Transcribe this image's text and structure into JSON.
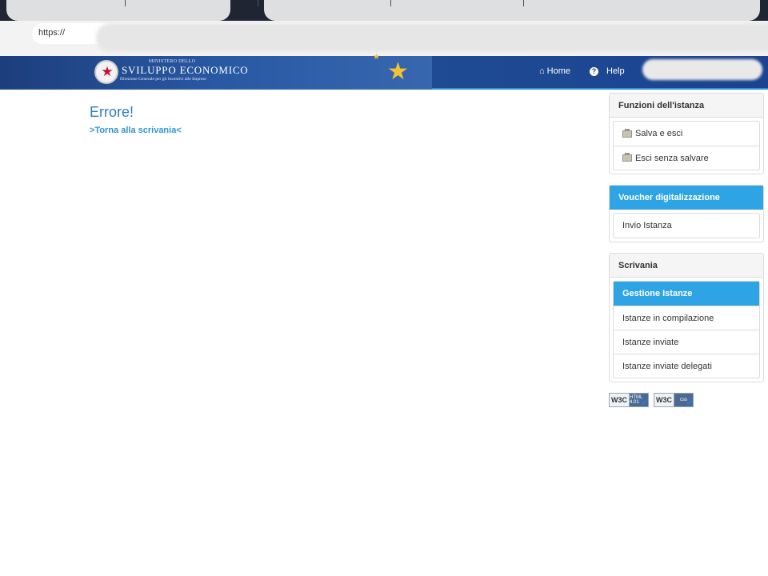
{
  "browser": {
    "url_prefix": "https://"
  },
  "header": {
    "brand_kicker": "MINISTERO DELLO",
    "brand_title": "SVILUPPO ECONOMICO",
    "brand_subtitle": "Direzione Generale per gli Incentivi alle Imprese",
    "nav": {
      "home": "Home",
      "help": "Help"
    }
  },
  "main": {
    "title": "Errore!",
    "back_link": ">Torna alla scrivania<"
  },
  "sidebar": {
    "funzioni": {
      "title": "Funzioni dell'istanza",
      "items": [
        "Salva e esci",
        "Esci senza salvare"
      ]
    },
    "voucher": {
      "title": "Voucher digitalizzazione",
      "items": [
        "Invio Istanza"
      ]
    },
    "scrivania": {
      "title": "Scrivania",
      "items": [
        "Gestione Istanze",
        "Istanze in compilazione",
        "Istanze inviate",
        "Istanze inviate delegati"
      ],
      "active_index": 0
    }
  },
  "badges": {
    "w3c_html": {
      "left": "W3C",
      "right": "HTML 4.01"
    },
    "w3c_css": {
      "left": "W3C",
      "right": "css"
    }
  },
  "colors": {
    "accent": "#2fa4e4",
    "header": "#1f4a92",
    "title": "#2f7dbd"
  }
}
